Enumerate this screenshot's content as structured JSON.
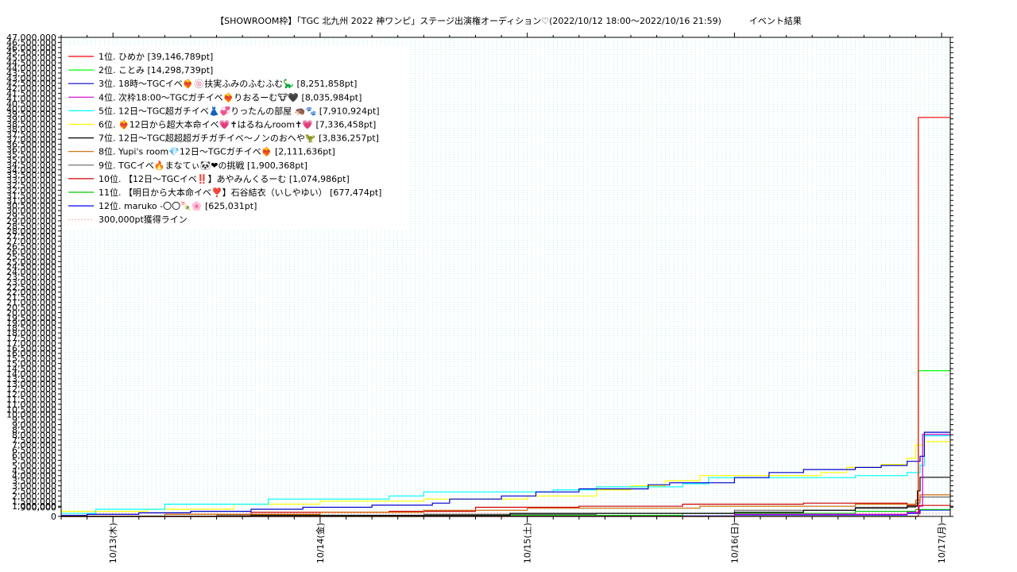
{
  "chart_data": {
    "type": "line",
    "title": "【SHOWROOM枠】「TGC 北九州 2022 神ワンピ」ステージ出演権オーディション♡(2022/10/12 18:00〜2022/10/16 21:59)          イベント結果",
    "xlabel": "",
    "ylabel": "",
    "ylim": [
      0,
      47000000
    ],
    "y_ticks": [
      0,
      900000,
      1000000,
      1500000,
      2000000,
      2500000,
      3000000,
      3500000,
      4000000,
      4500000,
      5000000,
      5500000,
      6000000,
      6500000,
      7000000,
      7500000,
      8000000,
      8500000,
      9000000,
      9500000,
      10000000,
      10500000,
      11000000,
      11500000,
      12000000,
      12500000,
      13000000,
      13500000,
      14000000,
      14500000,
      15000000,
      15500000,
      16000000,
      16500000,
      17000000,
      17500000,
      18000000,
      18500000,
      19000000,
      19500000,
      20000000,
      20500000,
      21000000,
      21500000,
      22000000,
      22500000,
      23000000,
      23500000,
      24000000,
      24500000,
      25000000,
      25500000,
      26000000,
      26500000,
      27000000,
      27500000,
      28000000,
      28500000,
      29000000,
      29500000,
      30000000,
      30500000,
      31000000,
      31500000,
      32000000,
      32500000,
      33000000,
      33500000,
      34000000,
      34500000,
      35000000,
      35500000,
      36000000,
      36500000,
      37000000,
      37500000,
      38000000,
      38500000,
      39000000,
      39500000,
      40000000,
      40500000,
      41000000,
      41500000,
      42000000,
      42500000,
      43000000,
      43500000,
      44000000,
      44500000,
      45000000,
      45500000,
      46000000,
      46500000,
      47000000
    ],
    "x_range_hours": [
      18,
      121
    ],
    "x_ticks": [
      {
        "hour": 24,
        "label": "10/13(木)"
      },
      {
        "hour": 48,
        "label": "10/14(金)"
      },
      {
        "hour": 72,
        "label": "10/15(土)"
      },
      {
        "hour": 96,
        "label": "10/16(日)"
      },
      {
        "hour": 120,
        "label": "10/17(月)"
      }
    ],
    "grid": true,
    "legend_position": "top-left",
    "threshold": {
      "name": "300,000pt獲得ライン",
      "value": 300000,
      "color": "#ffaaaa"
    },
    "series": [
      {
        "name": "1位. ひめか [39,146,789pt]",
        "color": "#ff0000",
        "points": [
          [
            18,
            0
          ],
          [
            117.2,
            0
          ],
          [
            117.3,
            39146789
          ],
          [
            121,
            39146789
          ]
        ]
      },
      {
        "name": "2位. ことみ [14,298,739pt]",
        "color": "#00ff00",
        "points": [
          [
            18,
            0
          ],
          [
            117.2,
            0
          ],
          [
            117.3,
            14298739
          ],
          [
            121,
            14298739
          ]
        ]
      },
      {
        "name": "3位. 18時〜TGCイベ❤️‍🔥🍥扶実ふみのふむふむ🦕 [8,251,858pt]",
        "color": "#0000cc",
        "points": [
          [
            18,
            100000
          ],
          [
            21,
            200000
          ],
          [
            27,
            350000
          ],
          [
            33,
            500000
          ],
          [
            40,
            700000
          ],
          [
            46,
            900000
          ],
          [
            54,
            1100000
          ],
          [
            61,
            1300000
          ],
          [
            63,
            1700000
          ],
          [
            69,
            2000000
          ],
          [
            73,
            2400000
          ],
          [
            78,
            2700000
          ],
          [
            86,
            3100000
          ],
          [
            88.5,
            3300000
          ],
          [
            96,
            3800000
          ],
          [
            100,
            4300000
          ],
          [
            104,
            4600000
          ],
          [
            110,
            4800000
          ],
          [
            113,
            5000000
          ],
          [
            116,
            5400000
          ],
          [
            117.5,
            5900000
          ],
          [
            118,
            8251858
          ],
          [
            121,
            8251858
          ]
        ]
      },
      {
        "name": "4位. 次枠18:00〜TGCガチイベ❤️‍🔥りおるーむ🐮🖤 [8,035,984pt]",
        "color": "#cc00cc",
        "points": [
          [
            18,
            0
          ],
          [
            96,
            200000
          ],
          [
            116,
            400000
          ],
          [
            117.4,
            1000000
          ],
          [
            117.8,
            8035984
          ],
          [
            121,
            8035984
          ]
        ]
      },
      {
        "name": "5位. 12日〜TGC超ガチイベ👗💞りったんの部屋 🦔🐾 [7,910,924pt]",
        "color": "#00ffff",
        "points": [
          [
            18,
            300000
          ],
          [
            22,
            700000
          ],
          [
            30,
            1200000
          ],
          [
            42,
            1700000
          ],
          [
            56,
            2000000
          ],
          [
            60,
            2400000
          ],
          [
            75,
            2600000
          ],
          [
            80,
            2900000
          ],
          [
            90,
            3200000
          ],
          [
            93,
            3800000
          ],
          [
            110,
            4000000
          ],
          [
            116,
            4300000
          ],
          [
            117.5,
            5000000
          ],
          [
            118,
            7910924
          ],
          [
            121,
            7910924
          ]
        ]
      },
      {
        "name": "6位. ❤️‍🔥12日から超大本命イベ💗✝はるねんroom✝💗 [7,336,458pt]",
        "color": "#ffff00",
        "points": [
          [
            18,
            500000
          ],
          [
            28,
            700000
          ],
          [
            38,
            1200000
          ],
          [
            48,
            1500000
          ],
          [
            60,
            1700000
          ],
          [
            72,
            2000000
          ],
          [
            80,
            2600000
          ],
          [
            84,
            3000000
          ],
          [
            88,
            3500000
          ],
          [
            92,
            4000000
          ],
          [
            106,
            4300000
          ],
          [
            109,
            4800000
          ],
          [
            113,
            5100000
          ],
          [
            116,
            5700000
          ],
          [
            117,
            7000000
          ],
          [
            118,
            7336458
          ],
          [
            121,
            7336458
          ]
        ]
      },
      {
        "name": "7位. 12日〜TGC超超超ガチガチイベ〜ノンのおへや🦖 [3,836,257pt]",
        "color": "#000000",
        "points": [
          [
            18,
            0
          ],
          [
            40,
            100000
          ],
          [
            70,
            300000
          ],
          [
            96,
            400000
          ],
          [
            104,
            600000
          ],
          [
            110,
            800000
          ],
          [
            116,
            1000000
          ],
          [
            117.2,
            2500000
          ],
          [
            117.5,
            3836257
          ],
          [
            121,
            3836257
          ]
        ]
      },
      {
        "name": "8位. Yupi's room💎12日〜TGCガチイベ❤️‍🔥 [2,111,636pt]",
        "color": "#cc6600",
        "points": [
          [
            18,
            0
          ],
          [
            30,
            200000
          ],
          [
            48,
            400000
          ],
          [
            60,
            600000
          ],
          [
            72,
            800000
          ],
          [
            92,
            1000000
          ],
          [
            110,
            1200000
          ],
          [
            117,
            1600000
          ],
          [
            117.5,
            2111636
          ],
          [
            121,
            2111636
          ]
        ]
      },
      {
        "name": "9位. TGCイベ🔥まなてぃ🐼❤の挑戦 [1,900,368pt]",
        "color": "#666666",
        "points": [
          [
            18,
            0
          ],
          [
            36,
            100000
          ],
          [
            60,
            200000
          ],
          [
            80,
            300000
          ],
          [
            96,
            600000
          ],
          [
            110,
            900000
          ],
          [
            117,
            1300000
          ],
          [
            117.5,
            1900368
          ],
          [
            121,
            1900368
          ]
        ]
      },
      {
        "name": "10位. 【12日〜TGCイベ‼️】あやみんくるーむ [1,074,986pt]",
        "color": "#cc0000",
        "points": [
          [
            18,
            0
          ],
          [
            40,
            400000
          ],
          [
            56,
            500000
          ],
          [
            66,
            900000
          ],
          [
            78,
            1000000
          ],
          [
            90,
            1200000
          ],
          [
            104,
            1300000
          ],
          [
            116,
            1074986
          ],
          [
            121,
            1074986
          ]
        ]
      },
      {
        "name": "11位. 【明日から大本命イベ❣️】石谷結衣（いしやゆい） [677,474pt]",
        "color": "#00cc00",
        "points": [
          [
            18,
            0
          ],
          [
            60,
            100000
          ],
          [
            90,
            300000
          ],
          [
            110,
            500000
          ],
          [
            117,
            677474
          ],
          [
            121,
            677474
          ]
        ]
      },
      {
        "name": "12位. maruko -〇〇🍡🌸 [625,031pt]",
        "color": "#0000ff",
        "points": [
          [
            18,
            0
          ],
          [
            50,
            50000
          ],
          [
            96,
            150000
          ],
          [
            116,
            300000
          ],
          [
            117.5,
            625031
          ],
          [
            121,
            625031
          ]
        ]
      }
    ]
  }
}
